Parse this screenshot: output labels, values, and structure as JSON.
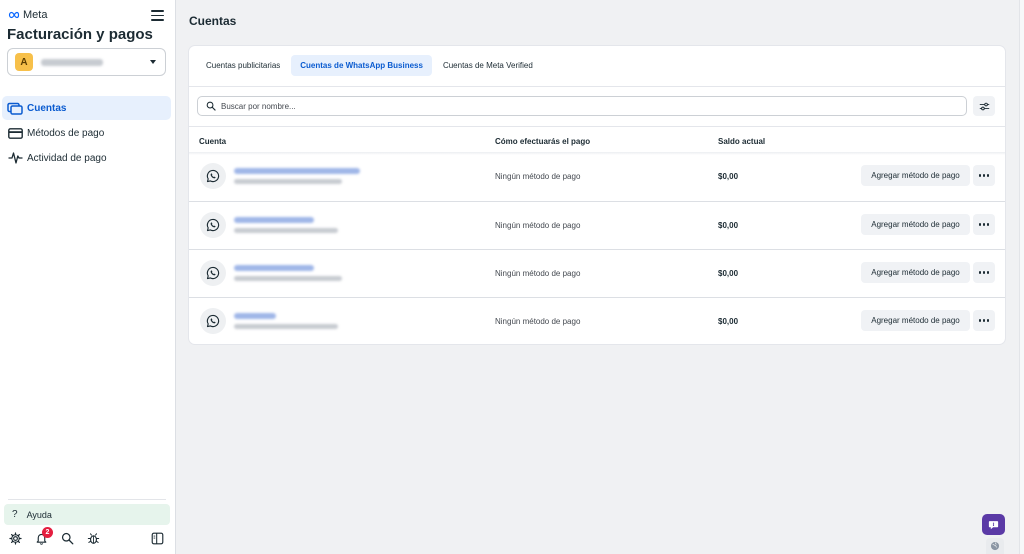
{
  "sidebar": {
    "brand": "Meta",
    "title": "Facturación y pagos",
    "account": {
      "avatar_letter": "A"
    },
    "nav": [
      {
        "label": "Cuentas",
        "icon": "accounts-icon",
        "active": true
      },
      {
        "label": "Métodos de pago",
        "icon": "credit-card-icon",
        "active": false
      },
      {
        "label": "Actividad de pago",
        "icon": "activity-icon",
        "active": false
      }
    ],
    "help_label": "Ayuda",
    "notification_count": "2"
  },
  "main": {
    "page_title": "Cuentas",
    "tabs": [
      {
        "label": "Cuentas publicitarias",
        "active": false
      },
      {
        "label": "Cuentas de WhatsApp Business",
        "active": true
      },
      {
        "label": "Cuentas de Meta Verified",
        "active": false
      }
    ],
    "search": {
      "placeholder": "Buscar por nombre..."
    },
    "table": {
      "headers": [
        "Cuenta",
        "Cómo efectuarás el pago",
        "Saldo actual"
      ],
      "rows": [
        {
          "payment_method": "Ningún método de pago",
          "balance": "$0,00",
          "action": "Agregar método de pago"
        },
        {
          "payment_method": "Ningún método de pago",
          "balance": "$0,00",
          "action": "Agregar método de pago"
        },
        {
          "payment_method": "Ningún método de pago",
          "balance": "$0,00",
          "action": "Agregar método de pago"
        },
        {
          "payment_method": "Ningún método de pago",
          "balance": "$0,00",
          "action": "Agregar método de pago"
        }
      ]
    }
  },
  "colors": {
    "accent": "#0a5bd0",
    "active_bg": "#e7f0fd",
    "chat_button": "#5b3aa6",
    "help_bg": "#e6f4ec",
    "badge": "#e41e3f"
  }
}
